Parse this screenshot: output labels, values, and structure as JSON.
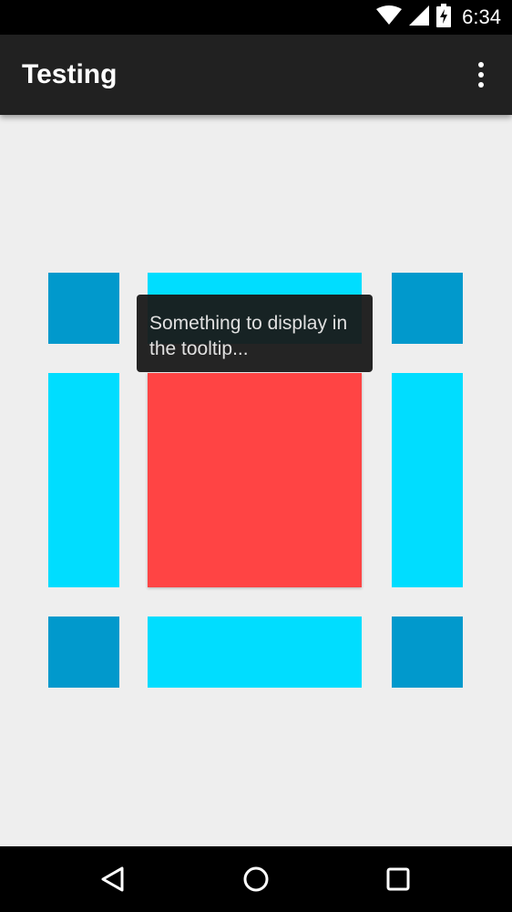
{
  "status_bar": {
    "time": "6:34",
    "icons": [
      "wifi-icon",
      "signal-icon",
      "battery-charging-icon"
    ]
  },
  "app_bar": {
    "title": "Testing",
    "menu_icon": "overflow-menu-icon"
  },
  "tooltip": {
    "text": "Something to display in the tooltip..."
  },
  "colors": {
    "background": "#eeeeee",
    "app_bar": "#212121",
    "tile_dark_blue": "#0199cc",
    "tile_light_blue": "#00ddff",
    "center_red": "#ff4444"
  },
  "nav_bar": {
    "buttons": [
      "back-icon",
      "home-icon",
      "recents-icon"
    ]
  }
}
